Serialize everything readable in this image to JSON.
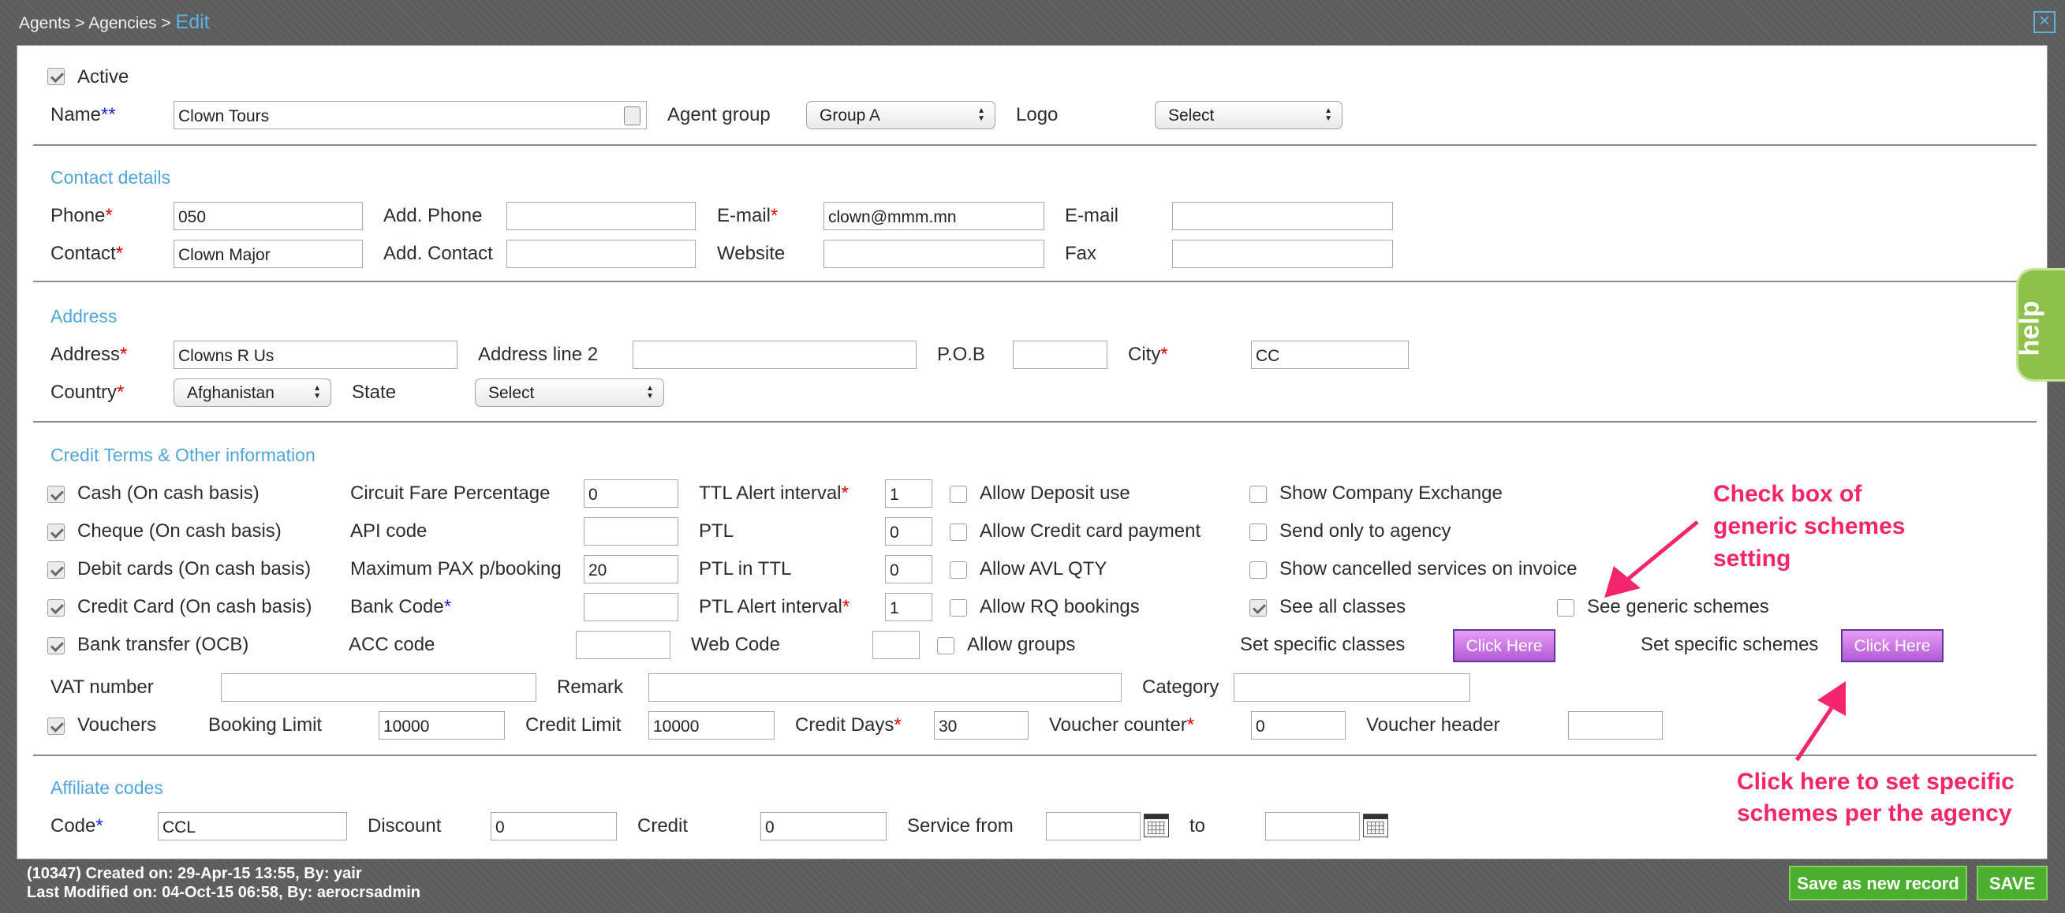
{
  "breadcrumb": {
    "agents": "Agents",
    "agencies": "Agencies",
    "current": "Edit",
    "sep": ">"
  },
  "header": {
    "active_label": "Active",
    "name_label": "Name",
    "name_value": "Clown Tours",
    "agent_group_label": "Agent group",
    "agent_group_value": "Group A",
    "logo_label": "Logo",
    "logo_value": "Select"
  },
  "contact": {
    "title": "Contact details",
    "phone_label": "Phone",
    "phone_value": "050",
    "add_phone_label": "Add. Phone",
    "add_phone_value": "",
    "email_label": "E-mail",
    "email_value": "clown@mmm.mn",
    "email2_label": "E-mail",
    "email2_value": "",
    "contact_label": "Contact",
    "contact_value": "Clown Major",
    "add_contact_label": "Add. Contact",
    "add_contact_value": "",
    "website_label": "Website",
    "website_value": "",
    "fax_label": "Fax",
    "fax_value": ""
  },
  "address": {
    "title": "Address",
    "address_label": "Address",
    "address_value": "Clowns R Us",
    "line2_label": "Address line 2",
    "line2_value": "",
    "pob_label": "P.O.B",
    "pob_value": "",
    "city_label": "City",
    "city_value": "CC",
    "country_label": "Country",
    "country_value": "Afghanistan",
    "state_label": "State",
    "state_value": "Select"
  },
  "credit": {
    "title": "Credit Terms & Other information",
    "payments": [
      {
        "label": "Cash (On cash basis)",
        "checked": true
      },
      {
        "label": "Cheque (On cash basis)",
        "checked": true
      },
      {
        "label": "Debit cards (On cash basis)",
        "checked": true
      },
      {
        "label": "Credit Card (On cash basis)",
        "checked": true
      },
      {
        "label": "Bank transfer (OCB)",
        "checked": true
      }
    ],
    "circuit_fare_label": "Circuit Fare Percentage",
    "circuit_fare_value": "0",
    "api_code_label": "API code",
    "api_code_value": "",
    "max_pax_label": "Maximum PAX p/booking",
    "max_pax_value": "20",
    "bank_code_label": "Bank Code",
    "bank_code_value": "",
    "acc_code_label": "ACC code",
    "acc_code_value": "",
    "ttl_alert_label": "TTL Alert interval",
    "ttl_alert_value": "1",
    "ptl_label": "PTL",
    "ptl_value": "0",
    "ptl_in_ttl_label": "PTL in TTL",
    "ptl_in_ttl_value": "0",
    "ptl_alert_label": "PTL Alert interval",
    "ptl_alert_value": "1",
    "web_code_label": "Web Code",
    "web_code_value": "",
    "allow_deposit_label": "Allow Deposit use",
    "allow_cc_label": "Allow Credit card payment",
    "allow_avl_label": "Allow AVL QTY",
    "allow_rq_label": "Allow RQ bookings",
    "allow_groups_label": "Allow groups",
    "show_exchange_label": "Show Company Exchange",
    "send_only_label": "Send only to agency",
    "show_cancelled_label": "Show cancelled services on invoice",
    "see_all_classes_label": "See all classes",
    "see_all_classes_checked": true,
    "see_generic_label": "See generic schemes",
    "set_classes_label": "Set specific classes",
    "set_classes_button": "Click Here",
    "set_schemes_label": "Set specific schemes",
    "set_schemes_button": "Click Here",
    "vat_label": "VAT number",
    "vat_value": "",
    "remark_label": "Remark",
    "remark_value": "",
    "category_label": "Category",
    "category_value": "",
    "vouchers_label": "Vouchers",
    "booking_limit_label": "Booking Limit",
    "booking_limit_value": "10000",
    "credit_limit_label": "Credit Limit",
    "credit_limit_value": "10000",
    "credit_days_label": "Credit Days",
    "credit_days_value": "30",
    "voucher_counter_label": "Voucher counter",
    "voucher_counter_value": "0",
    "voucher_header_label": "Voucher header",
    "voucher_header_value": ""
  },
  "affiliate": {
    "title": "Affiliate codes",
    "code_label": "Code",
    "code_value": "CCL",
    "discount_label": "Discount",
    "discount_value": "0",
    "credit_label": "Credit",
    "credit_value": "0",
    "service_from_label": "Service from",
    "service_from_value": "",
    "to_label": "to",
    "to_value": ""
  },
  "annotations": {
    "generic": [
      "Check box of",
      "generic schemes",
      "setting"
    ],
    "specific": [
      "Click here to set specific",
      "schemes per the agency"
    ]
  },
  "help_label": "help",
  "footer": {
    "created": "(10347) Created on: 29-Apr-15 13:55, By: yair",
    "modified": "Last Modified on: 04-Oct-15 06:58, By: aerocrsadmin"
  },
  "buttons": {
    "save_new": "Save as new record",
    "save": "SAVE"
  },
  "colors": {
    "section_title": "#4fa5dc",
    "annotation": "#f4246d",
    "save_green": "#4cae2e",
    "click_here_purple": "#c77ce6"
  }
}
